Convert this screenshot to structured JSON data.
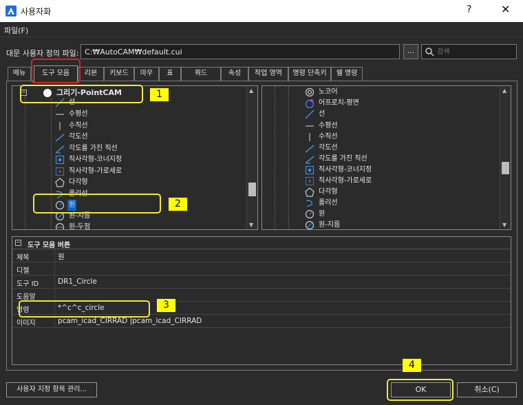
{
  "window": {
    "title": "사용자화",
    "help_label": "?",
    "close_label": "✕"
  },
  "menu": {
    "file_label": "파일(F)"
  },
  "file_row": {
    "label": "대문 사용자 정의 파일:",
    "path": "C:₩AutoCAM₩default.cui",
    "browse_label": "...",
    "search_placeholder": "검색"
  },
  "tabs": [
    {
      "label": "메뉴"
    },
    {
      "label": "도구 모음",
      "active": true
    },
    {
      "label": "리본"
    },
    {
      "label": "키보드"
    },
    {
      "label": "마우"
    },
    {
      "label": "표"
    },
    {
      "label": "쿼드"
    },
    {
      "label": "속성"
    },
    {
      "label": "작업 영역"
    },
    {
      "label": "명령 단축키"
    },
    {
      "label": "쉘 명령"
    }
  ],
  "left_tree": {
    "root_label": "그리기-PointCAM",
    "items": [
      {
        "label": "선",
        "icon": "line-icon"
      },
      {
        "label": "수평선",
        "icon": "horizontal-line-icon"
      },
      {
        "label": "수직선",
        "icon": "vertical-line-icon"
      },
      {
        "label": "각도선",
        "icon": "angled-line-icon"
      },
      {
        "label": "각도를 가진 직선",
        "icon": "angle-line-icon"
      },
      {
        "label": "직사각형-코너지정",
        "icon": "rectangle-corner-icon"
      },
      {
        "label": "직사각형-가로세로",
        "icon": "rectangle-size-icon"
      },
      {
        "label": "다각형",
        "icon": "polygon-icon"
      },
      {
        "label": "폴리선",
        "icon": "polyline-icon"
      },
      {
        "label": "원",
        "icon": "circle-icon",
        "selected": true
      },
      {
        "label": "원-지름",
        "icon": "circle-diameter-icon"
      },
      {
        "label": "원-두점",
        "icon": "circle-two-point-icon"
      }
    ]
  },
  "right_tree": {
    "items": [
      {
        "label": "노코어",
        "icon": "nocore-icon"
      },
      {
        "label": "어프로치-평면",
        "icon": "approach-plane-icon"
      },
      {
        "label": "선",
        "icon": "line-icon"
      },
      {
        "label": "수평선",
        "icon": "horizontal-line-icon"
      },
      {
        "label": "수직선",
        "icon": "vertical-line-icon"
      },
      {
        "label": "각도선",
        "icon": "angled-line-icon"
      },
      {
        "label": "각도를 가진 직선",
        "icon": "angle-line-icon"
      },
      {
        "label": "직사각형-코너지정",
        "icon": "rectangle-corner-icon"
      },
      {
        "label": "직사각형-가로세로",
        "icon": "rectangle-size-icon"
      },
      {
        "label": "다각형",
        "icon": "polygon-icon"
      },
      {
        "label": "폴리선",
        "icon": "polyline-icon"
      },
      {
        "label": "원",
        "icon": "circle-icon"
      },
      {
        "label": "원-지름",
        "icon": "circle-diameter-icon"
      }
    ]
  },
  "properties": {
    "header": "도구 모음 버튼",
    "rows": [
      {
        "key": "제목",
        "value": "원"
      },
      {
        "key": "디젤",
        "value": ""
      },
      {
        "key": "도구 ID",
        "value": "DR1_Circle"
      },
      {
        "key": "도움말",
        "value": ""
      },
      {
        "key": "명령",
        "value": "*^c^c_circle"
      },
      {
        "key": "이미지",
        "value": "pcam_icad_CIRRAD    |pcam_icad_CIRRAD"
      }
    ]
  },
  "buttons": {
    "manage": "사용자 지정 항목 관리...",
    "ok": "OK",
    "cancel": "취소(C)"
  },
  "annotations": [
    "1",
    "2",
    "3",
    "4"
  ],
  "colors": {
    "highlight": "#f2ea33",
    "tab_highlight": "#e02020",
    "badge": "#ffff00",
    "icon_blue": "#3a8ee6",
    "selection": "#0a64c8"
  }
}
